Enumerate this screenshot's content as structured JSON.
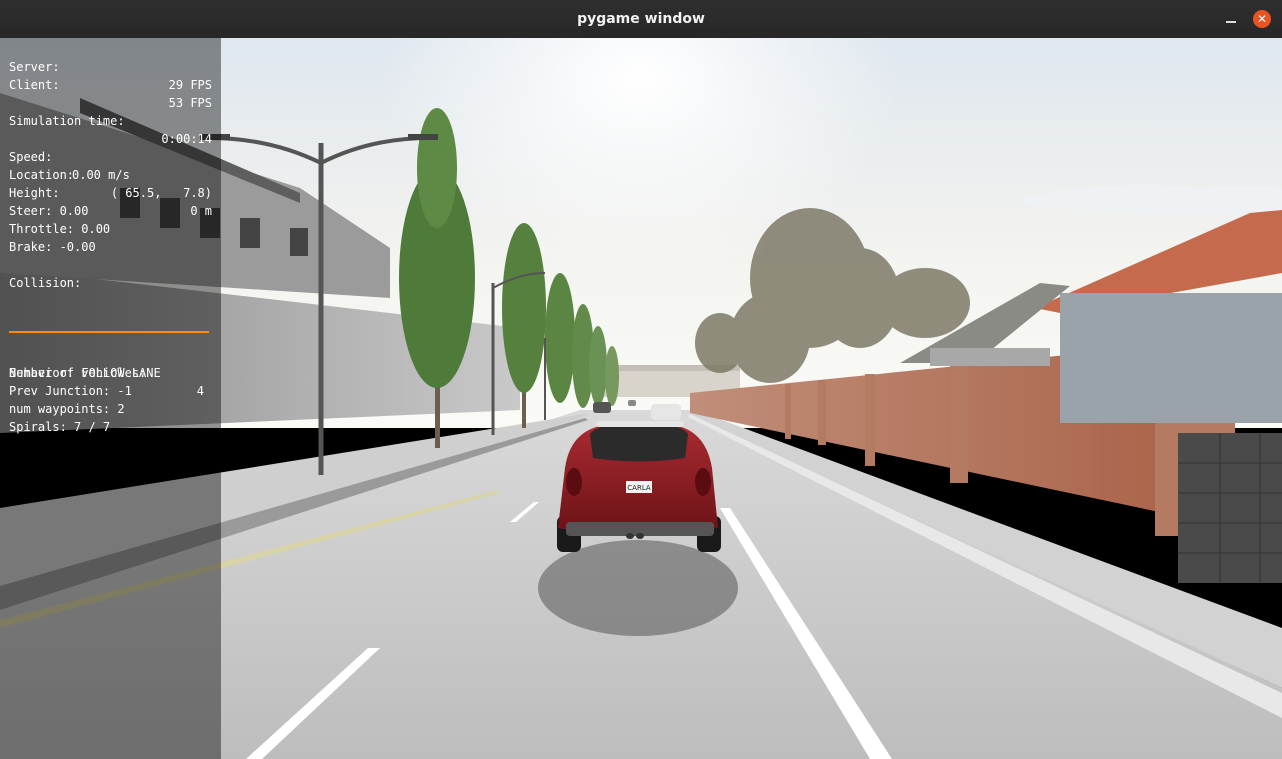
{
  "window": {
    "title": "pygame window",
    "minimize_glyph": "",
    "close_glyph": "✕"
  },
  "hud": {
    "server_label": "Server:",
    "server_value": "29 FPS",
    "client_label": "Client:",
    "client_value": "53 FPS",
    "sim_time_label": "Simulation time:",
    "sim_time_value": "0:00:14",
    "speed_label": "Speed:",
    "speed_value": "0.00 m/s",
    "location_label": "Location:",
    "location_value": "( 65.5,   7.8)",
    "height_label": "Height:",
    "height_value": "0 m",
    "steer": "Steer: 0.00",
    "throttle": "Throttle: 0.00",
    "brake": "Brake: -0.00",
    "collision_label": "Collision:",
    "vehicles_label": "Number of vehicles:",
    "vehicles_value": "4",
    "behavior": "Behavior: FOLLOW LANE",
    "prev_junction": "Prev Junction: -1",
    "num_waypoints": "num waypoints: 2",
    "spirals": "Spirals: 7 / 7",
    "bar_color": "#ff8c00"
  },
  "scene": {
    "license_plate": "CARLA",
    "car_color": "#8b1a1f",
    "wall_color": "#a5614a",
    "roof_color": "#c66a4e"
  }
}
